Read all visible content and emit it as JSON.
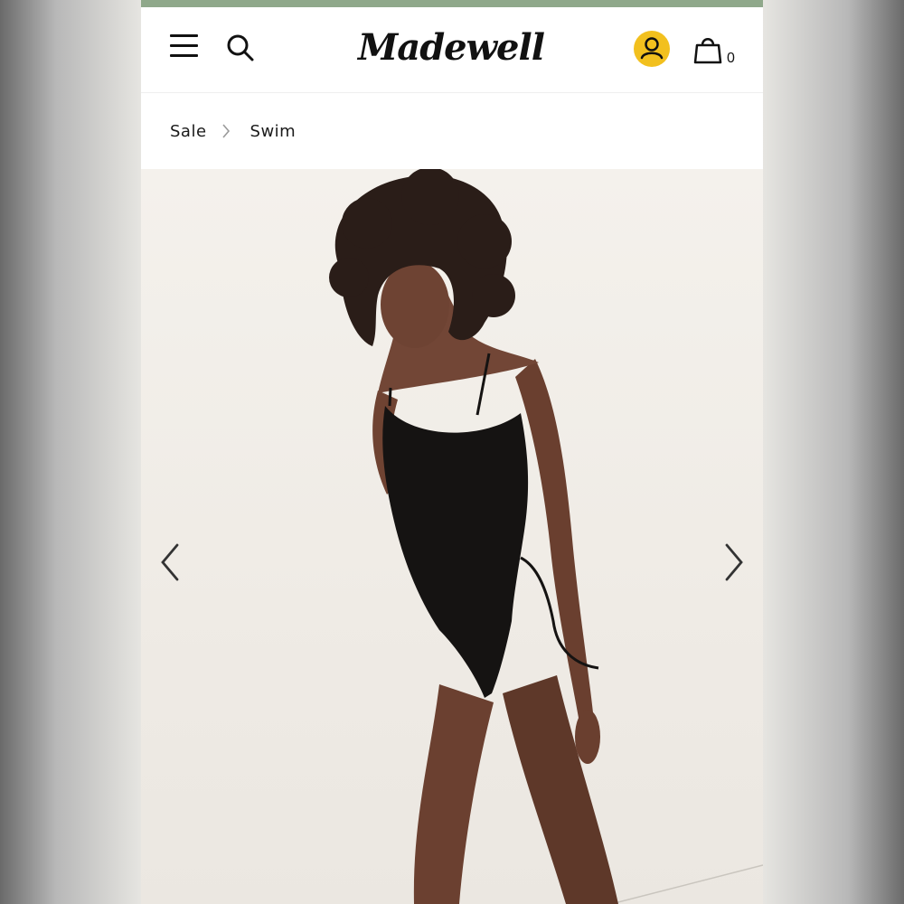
{
  "colors": {
    "top_strip": "#8fa88a",
    "account_circle": "#f2c01e",
    "text": "#111111"
  },
  "header": {
    "menu_icon": "hamburger-menu-icon",
    "search_icon": "search-icon",
    "logo_text": "Madewell",
    "account_icon": "user-icon",
    "cart_icon": "shopping-bag-icon",
    "cart_count": "0"
  },
  "breadcrumb": {
    "items": [
      "Sale",
      "Swim"
    ],
    "separator_icon": "chevron-right-icon"
  },
  "carousel": {
    "image_alt": "Model wearing black one-piece swimsuit",
    "prev_icon": "chevron-left-icon",
    "next_icon": "chevron-right-icon"
  }
}
